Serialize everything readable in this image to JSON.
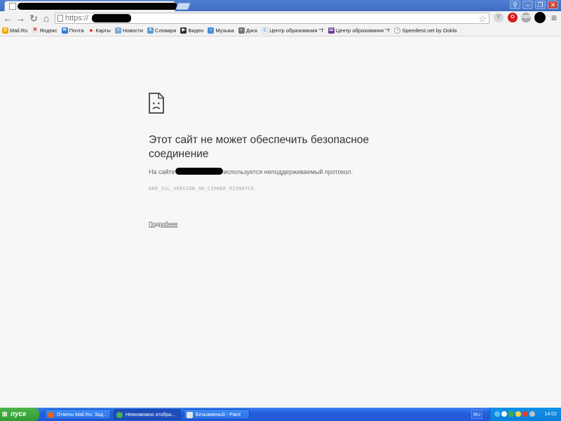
{
  "browser": {
    "url_prefix": "https://",
    "star_icon": "☆",
    "menu_icon": "≡"
  },
  "bookmarks": [
    {
      "label": "Mail.Ru",
      "icon": "mailru-icon",
      "color": "#f5a400"
    },
    {
      "label": "Яндекс",
      "icon": "yandex-icon",
      "color": "#e8e8e8"
    },
    {
      "label": "Почта",
      "icon": "mail-icon",
      "color": "#2f7bd6"
    },
    {
      "label": "Карты",
      "icon": "map-pin-icon",
      "color": "#e02b2b"
    },
    {
      "label": "Новости",
      "icon": "news-icon",
      "color": "#7aa9d8"
    },
    {
      "label": "Словари",
      "icon": "dictionary-icon",
      "color": "#5b9bd5"
    },
    {
      "label": "Видео",
      "icon": "video-icon",
      "color": "#333333"
    },
    {
      "label": "Музыка",
      "icon": "music-icon",
      "color": "#4a90d9"
    },
    {
      "label": "Диск",
      "icon": "disk-icon",
      "color": "#777777"
    },
    {
      "label": "Центр образования \"Т",
      "icon": "google-icon",
      "color": "#ffffff"
    },
    {
      "label": "Центр образования \"Т",
      "icon": "school-icon",
      "color": "#6a3d9a"
    },
    {
      "label": "Speedtest.net by Ookla",
      "icon": "speedtest-icon",
      "color": "#ffffff"
    }
  ],
  "error": {
    "title": "Этот сайт не может обеспечить безопасное соединение",
    "desc_prefix": "На сайте",
    "desc_suffix": "используется неподдерживаемый протокол.",
    "code": "ERR_SSL_VERSION_OR_CIPHER_MISMATCH",
    "details_link": "Подробнее"
  },
  "taskbar": {
    "start_label": "пуск",
    "tasks": [
      {
        "label": "Ответы Mail.Ru: Зад...",
        "active": false,
        "icon_color": "#e8641c"
      },
      {
        "label": "Невозможно отобра...",
        "active": true,
        "icon_color": "#4caf50"
      },
      {
        "label": "Безымянный - Paint",
        "active": false,
        "icon_color": "#e6e6e6"
      }
    ],
    "language": "RU",
    "clock": "14:02"
  }
}
